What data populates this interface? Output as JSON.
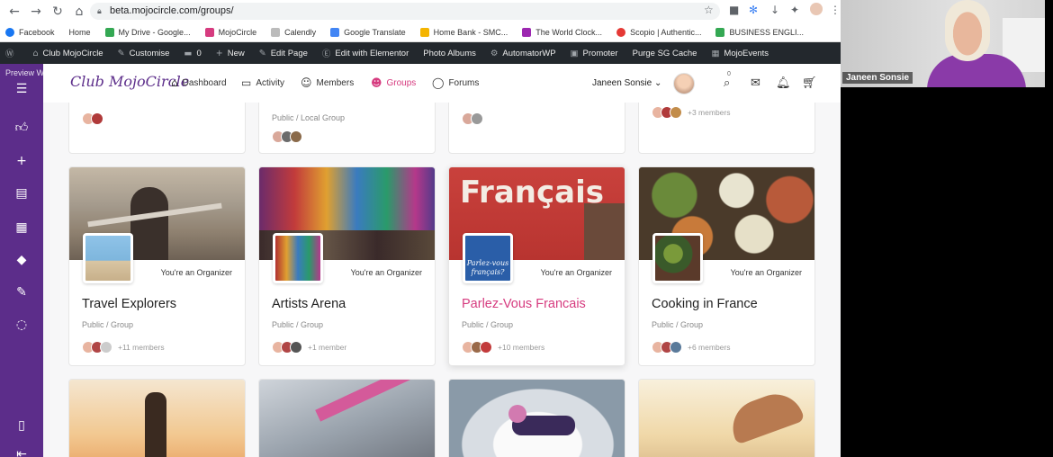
{
  "browser": {
    "url": "beta.mojocircle.com/groups/"
  },
  "bookmarks": [
    {
      "label": "Facebook",
      "color": "#1877f2"
    },
    {
      "label": "Home",
      "color": "#ffffff"
    },
    {
      "label": "My Drive - Google...",
      "color": "#34a853"
    },
    {
      "label": "MojoCircle",
      "color": "#d63b7f"
    },
    {
      "label": "Calendly",
      "color": "#888888"
    },
    {
      "label": "Google Translate",
      "color": "#4285f4"
    },
    {
      "label": "Home Bank - SMC...",
      "color": "#f4b400"
    },
    {
      "label": "The World Clock...",
      "color": "#9c27b0"
    },
    {
      "label": "Scopio | Authentic...",
      "color": "#e53935"
    },
    {
      "label": "BUSINESS ENGLI...",
      "color": "#34a853"
    }
  ],
  "wpbar": {
    "site": "Club MojoCircle",
    "customise": "Customise",
    "comments": "0",
    "new": "New",
    "edit_page": "Edit Page",
    "elementor": "Edit with Elementor",
    "albums": "Photo Albums",
    "automator": "AutomatorWP",
    "promoter": "Promoter",
    "purge": "Purge SG Cache",
    "events": "MojoEvents"
  },
  "preview": "Preview With",
  "header": {
    "logo": "Club MojoCircle",
    "nav": [
      {
        "label": "Dashboard"
      },
      {
        "label": "Activity"
      },
      {
        "label": "Members"
      },
      {
        "label": "Groups"
      },
      {
        "label": "Forums"
      }
    ],
    "user": "Janeen Sonsie",
    "cart_badge": "0"
  },
  "top_row": [
    {
      "type": "",
      "members": ""
    },
    {
      "type": "Public / Local Group",
      "members": ""
    },
    {
      "type": "",
      "members": ""
    },
    {
      "type": "",
      "members": "+3 members"
    }
  ],
  "groups": [
    {
      "name": "Travel Explorers",
      "role": "You're an Organizer",
      "type": "Public / Group",
      "members": "+11 members"
    },
    {
      "name": "Artists Arena",
      "role": "You're an Organizer",
      "type": "Public / Group",
      "members": "+1 member"
    },
    {
      "name": "Parlez-Vous Francais",
      "role": "You're an Organizer",
      "type": "Public / Group",
      "members": "+10 members",
      "cover_text": "Français",
      "thumb_text": "Parlez-vous français?"
    },
    {
      "name": "Cooking in France",
      "role": "You're an Organizer",
      "type": "Public / Group",
      "members": "+6 members"
    }
  ],
  "video": {
    "name": "Janeen Sonsie"
  }
}
